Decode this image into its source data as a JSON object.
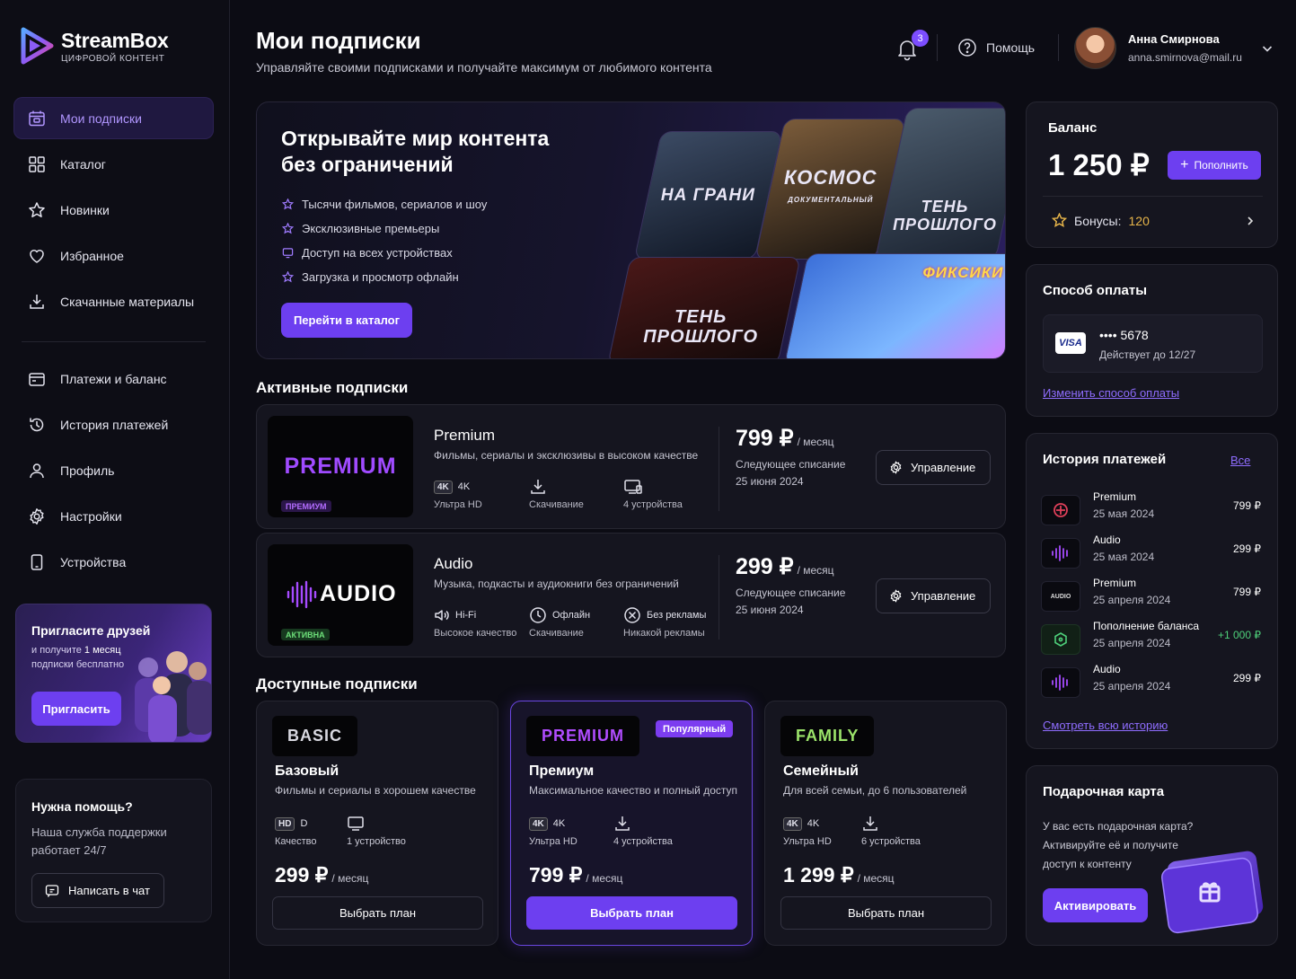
{
  "brand": {
    "name": "StreamBox",
    "tagline": "ЦИФРОВОЙ КОНТЕНТ"
  },
  "nav": [
    {
      "label": "Мои подписки",
      "icon": "subscriptions-icon",
      "active": true
    },
    {
      "label": "Каталог",
      "icon": "grid-icon"
    },
    {
      "label": "Новинки",
      "icon": "star-icon"
    },
    {
      "label": "Избранное",
      "icon": "heart-icon"
    },
    {
      "label": "Скачанные материалы",
      "icon": "download-icon"
    }
  ],
  "nav2": [
    {
      "label": "Платежи и баланс",
      "icon": "wallet-icon"
    },
    {
      "label": "История платежей",
      "icon": "history-icon"
    },
    {
      "label": "Профиль",
      "icon": "user-icon"
    },
    {
      "label": "Настройки",
      "icon": "settings-icon"
    },
    {
      "label": "Устройства",
      "icon": "device-icon"
    }
  ],
  "invite": {
    "title": "Пригласите друзей",
    "text_before": "и получите ",
    "text_bold": "1 месяц",
    "text_after": " подписки бесплатно",
    "button": "Пригласить"
  },
  "support": {
    "title": "Нужна помощь?",
    "text": "Наша служба поддержки работает 24/7",
    "button": "Написать в чат"
  },
  "header": {
    "title": "Мои подписки",
    "subtitle": "Управляйте своими подписками и получайте максимум от любимого контента",
    "notifications": "3",
    "help": "Помощь",
    "user_name": "Анна Смирнова",
    "user_email": "anna.smirnova@mail.ru"
  },
  "hero": {
    "title": "Открывайте мир контента без ограничений",
    "features": [
      "Тысячи фильмов, сериалов и шоу",
      "Эксклюзивные премьеры",
      "Доступ на всех устройствах",
      "Загрузка и просмотр офлайн"
    ],
    "button": "Перейти в каталог",
    "posters": [
      "НА ГРАНИ",
      "КОСМОС",
      "ТЕНЬ ПРОШЛОГО",
      "ТЕНЬ ПРОШЛОГО",
      "ФИКСИКИ"
    ],
    "poster_sub": "ДОКУМЕНТАЛЬНЫЙ"
  },
  "active_title": "Активные подписки",
  "active": [
    {
      "logo": "PREMIUM",
      "tag": "ПРЕМИУМ",
      "name": "Premium",
      "desc": "Фильмы, сериалы и эксклюзивы в высоком качестве",
      "features": [
        {
          "icon": "4k-icon",
          "top": "4K",
          "badge": "4K",
          "label": "Ультра HD"
        },
        {
          "icon": "download-icon",
          "top": "",
          "label": "Скачивание"
        },
        {
          "icon": "devices-icon",
          "top": "",
          "label": "4 устройства"
        }
      ],
      "price": "799 ₽",
      "period": "/ месяц",
      "next_label": "Следующее списание",
      "next_date": "25 июня 2024",
      "manage": "Управление"
    },
    {
      "logo": "AUDIO",
      "tag": "АКТИВНА",
      "name": "Audio",
      "desc": "Музыка, подкасты и аудиокниги без ограничений",
      "features": [
        {
          "icon": "hifi-icon",
          "top": "Hi-Fi",
          "label": "Высокое качество"
        },
        {
          "icon": "offline-icon",
          "top": "Офлайн",
          "label": "Скачивание"
        },
        {
          "icon": "no-ads-icon",
          "top": "Без рекламы",
          "label": "Никакой рекламы"
        }
      ],
      "price": "299 ₽",
      "period": "/ месяц",
      "next_label": "Следующее списание",
      "next_date": "25 июня 2024",
      "manage": "Управление"
    }
  ],
  "available_title": "Доступные подписки",
  "plans": [
    {
      "logo": "BASIC",
      "name": "Базовый",
      "desc": "Фильмы и сериалы в хорошем качестве",
      "f1_badge": "HD",
      "f1_top": "D",
      "f1_label": "Качество",
      "f2_label": "1 устройство",
      "price": "299 ₽",
      "period": "/ месяц",
      "button": "Выбрать план",
      "color": "#d8d8e0"
    },
    {
      "logo": "PREMIUM",
      "popular": "Популярный",
      "name": "Премиум",
      "desc": "Максимальное качество и полный доступ",
      "f1_badge": "4K",
      "f1_top": "4K",
      "f1_label": "Ультра HD",
      "f2_label": "4 устройства",
      "price": "799 ₽",
      "period": "/ месяц",
      "button": "Выбрать план",
      "color": "#b14dff"
    },
    {
      "logo": "FAMILY",
      "name": "Семейный",
      "desc": "Для всей семьи, до 6 пользователей",
      "f1_badge": "4K",
      "f1_top": "4K",
      "f1_label": "Ультра HD",
      "f2_label": "6 устройства",
      "price": "1 299 ₽",
      "period": "/ месяц",
      "button": "Выбрать план",
      "color": "#9be36a"
    }
  ],
  "balance": {
    "title": "Баланс",
    "amount": "1 250 ₽",
    "topup": "Пополнить",
    "bonus_label": "Бонусы:",
    "bonus_value": "120"
  },
  "payment": {
    "title": "Способ оплаты",
    "brand": "VISA",
    "number": "•••• 5678",
    "expires": "Действует до 12/27",
    "change": "Изменить способ оплаты"
  },
  "history": {
    "title": "История платежей",
    "all": "Все",
    "more": "Смотреть всю историю",
    "items": [
      {
        "name": "Premium",
        "date": "25 мая 2024",
        "amount": "799 ₽",
        "icon": "premium-icon"
      },
      {
        "name": "Audio",
        "date": "25 мая 2024",
        "amount": "299 ₽",
        "icon": "audio-wave-icon"
      },
      {
        "name": "Premium",
        "date": "25 апреля 2024",
        "amount": "799 ₽",
        "icon": "audio-logo-icon",
        "icon_text": "AUDIO"
      },
      {
        "name": "Пополнение баланса",
        "date": "25 апреля 2024",
        "amount": "+1 000 ₽",
        "icon": "wallet-icon"
      },
      {
        "name": "Audio",
        "date": "25 апреля 2024",
        "amount": "299 ₽",
        "icon": "audio-wave-icon"
      }
    ]
  },
  "gift": {
    "title": "Подарочная карта",
    "text": "У вас есть подарочная карта? Активируйте её и получите доступ к контенту",
    "button": "Активировать"
  },
  "colors": {
    "accent": "#6d3ff0",
    "bonus": "#e7b54a",
    "positive": "#4ed07a"
  }
}
